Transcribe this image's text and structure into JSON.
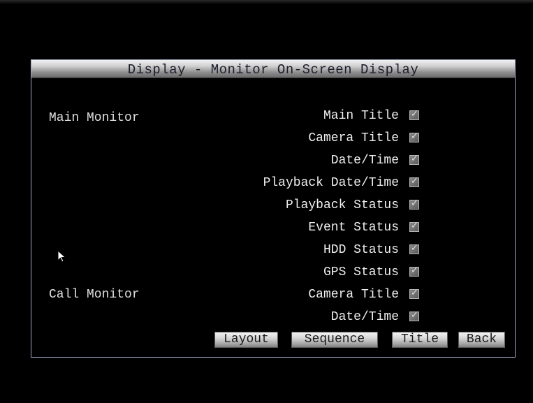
{
  "dialog": {
    "title": "Display - Monitor On-Screen Display"
  },
  "sections": {
    "main_monitor": "Main Monitor",
    "call_monitor": "Call Monitor"
  },
  "items": [
    {
      "label": "Main Title",
      "checked": true
    },
    {
      "label": "Camera Title",
      "checked": true
    },
    {
      "label": "Date/Time",
      "checked": true
    },
    {
      "label": "Playback Date/Time",
      "checked": true
    },
    {
      "label": "Playback Status",
      "checked": true
    },
    {
      "label": "Event Status",
      "checked": true
    },
    {
      "label": "HDD Status",
      "checked": true
    },
    {
      "label": "GPS Status",
      "checked": true
    },
    {
      "label": "Camera Title",
      "checked": true
    },
    {
      "label": "Date/Time",
      "checked": true
    }
  ],
  "buttons": {
    "layout": "Layout",
    "sequence": "Sequence",
    "title": "Title",
    "back": "Back"
  },
  "icons": {
    "cursor": "mouse-pointer-icon",
    "checkbox": "check-icon"
  },
  "colors": {
    "background": "#000000",
    "border": "#9aa6c0",
    "text": "#e8e8e8"
  }
}
